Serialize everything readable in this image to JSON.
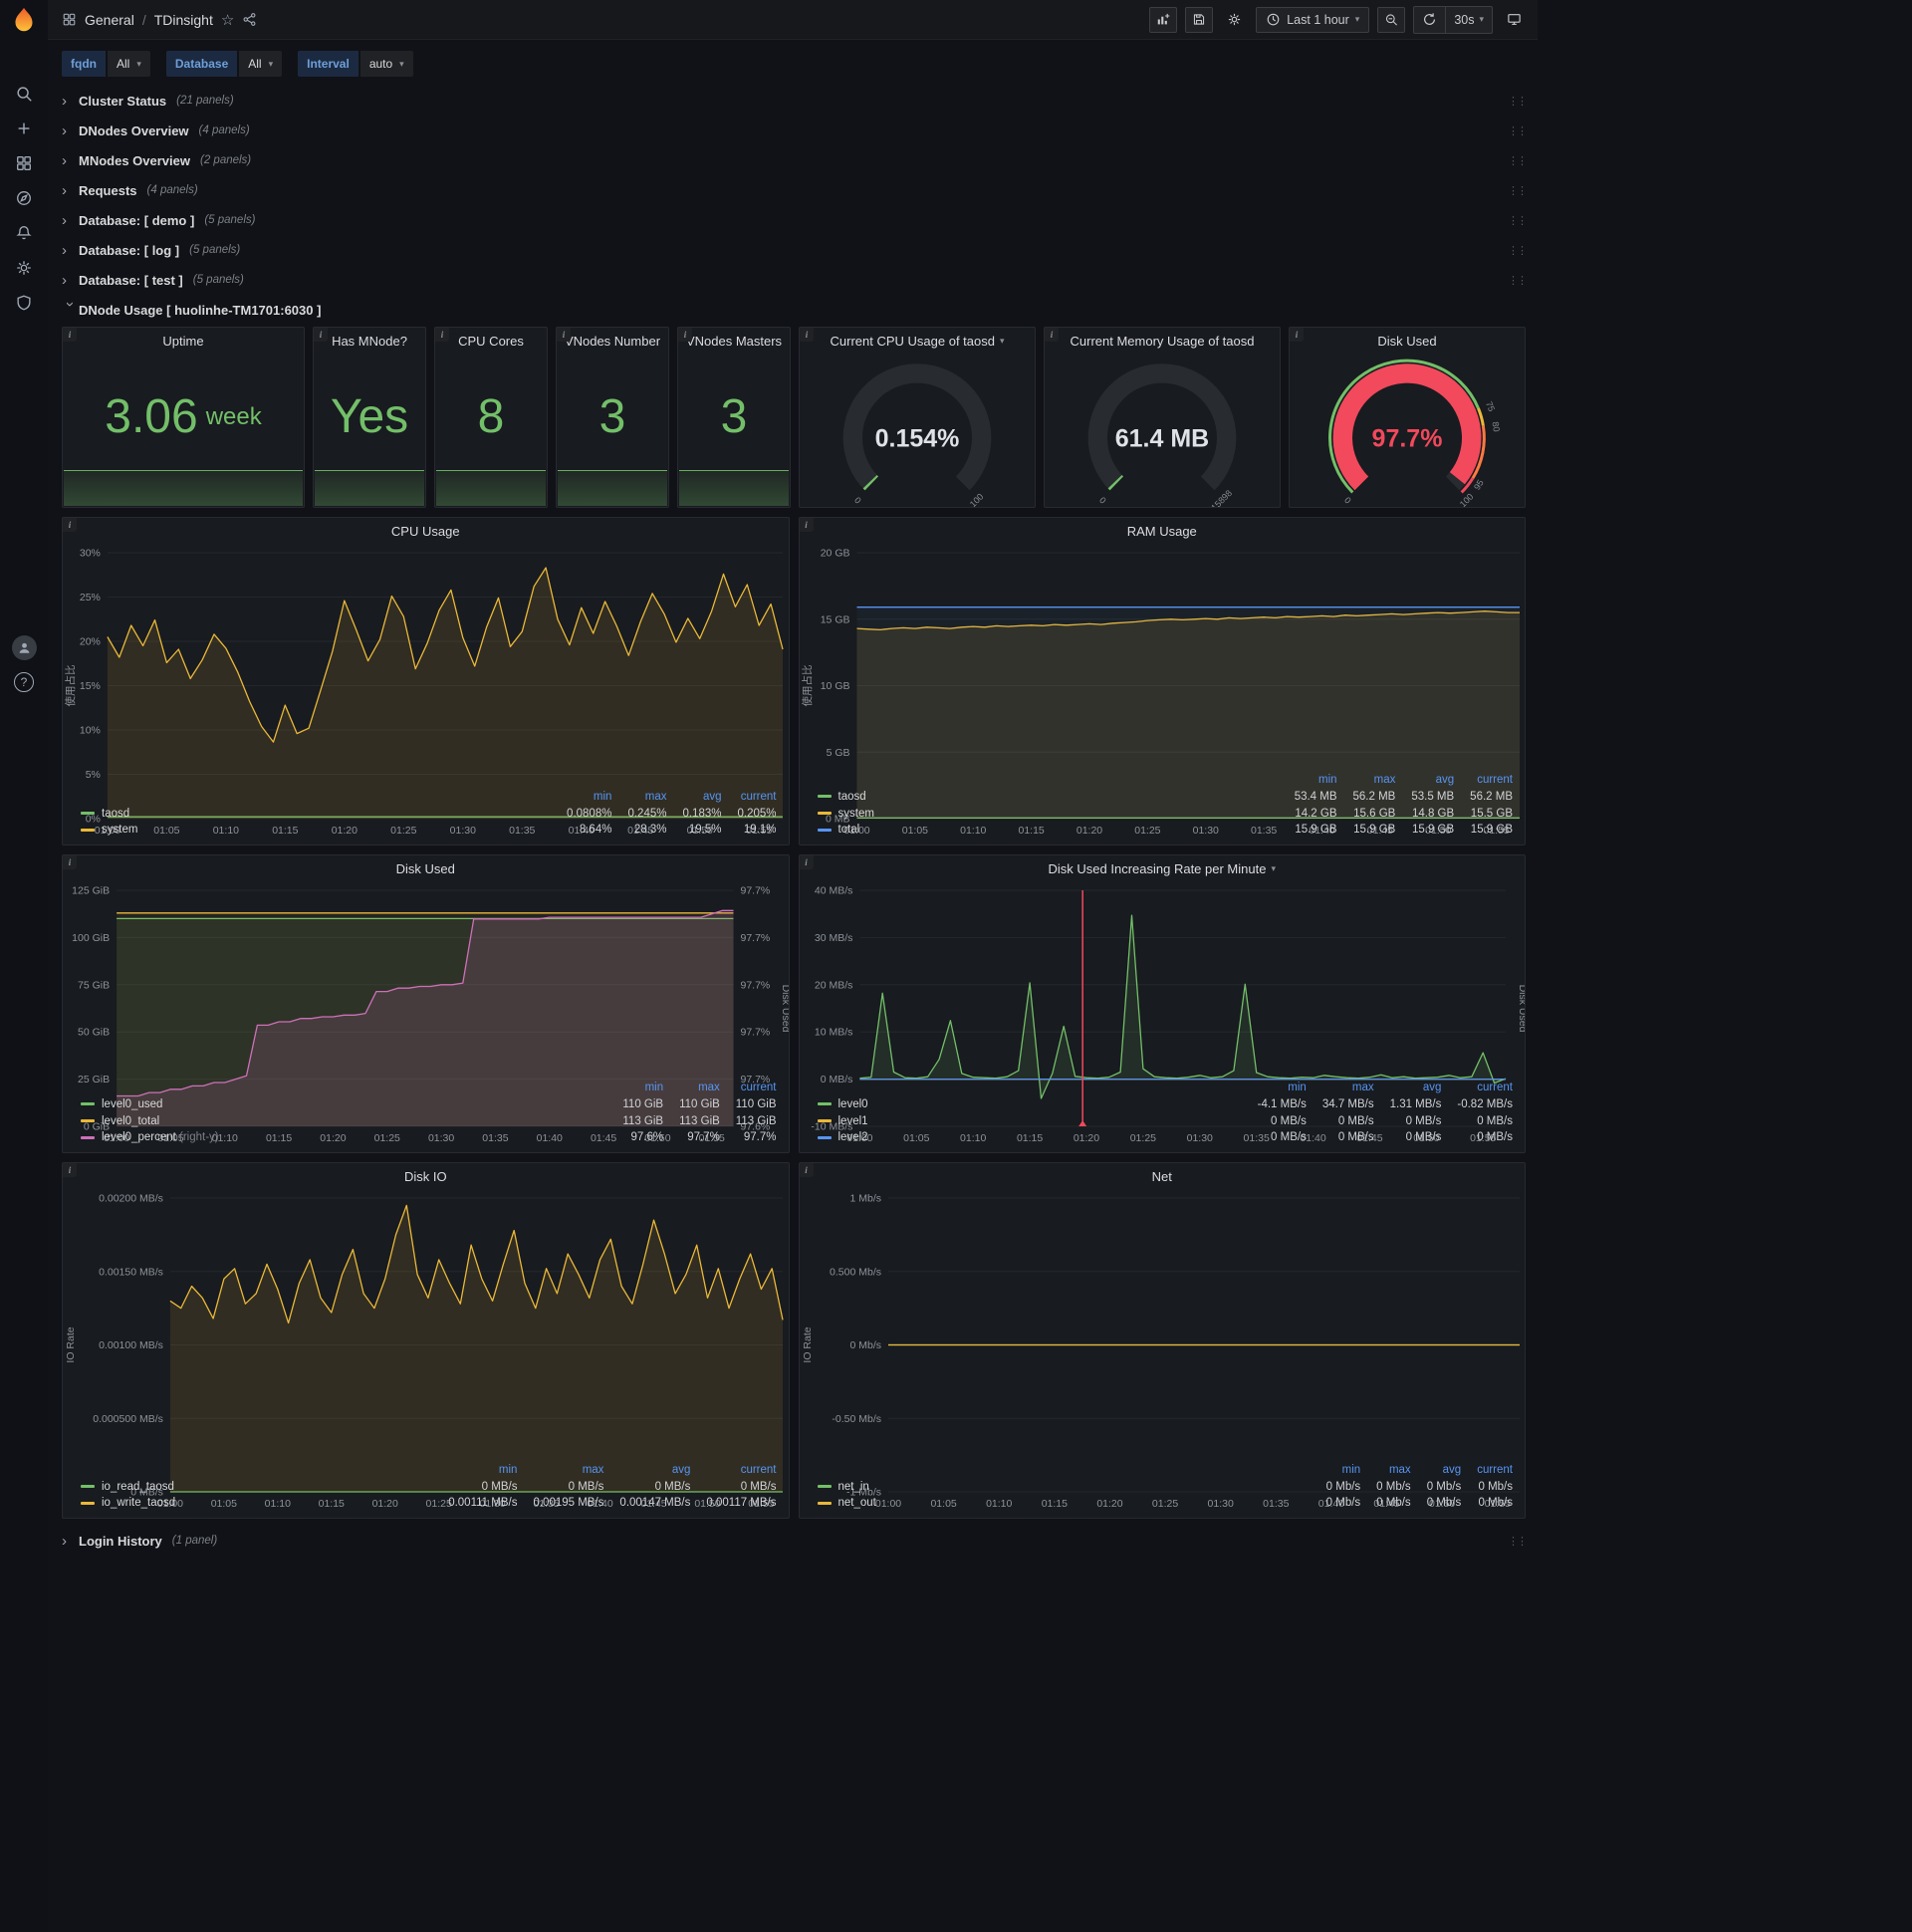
{
  "colors": {
    "green": "#73bf69",
    "yellow": "#eab839",
    "blue": "#5794f2",
    "red": "#f2495c",
    "pink": "#ce70b8",
    "orange": "#ff7941",
    "legend_header": "#5794f2"
  },
  "icons": {
    "info": "i",
    "chevron_right": "›",
    "caret_down": "▾",
    "star": "☆",
    "drag_dots": "⋮⋮",
    "help": "?"
  },
  "sidebar": {
    "icons": [
      "search",
      "plus",
      "dashboards",
      "explore",
      "alerting",
      "settings",
      "shield"
    ],
    "bottom_icons": [
      "avatar",
      "help"
    ]
  },
  "header": {
    "breadcrumb": {
      "section": "General",
      "separator": "/",
      "title": "TDinsight"
    },
    "time_picker": {
      "label": "Last 1 hour"
    },
    "refresh": {
      "interval": "30s"
    }
  },
  "variables": [
    {
      "label": "fqdn",
      "value": "All"
    },
    {
      "label": "Database",
      "value": "All"
    },
    {
      "label": "Interval",
      "value": "auto"
    }
  ],
  "rows_top": [
    {
      "title": "Cluster Status",
      "count": "(21 panels)"
    },
    {
      "title": "DNodes Overview",
      "count": "(4 panels)"
    },
    {
      "title": "MNodes Overview",
      "count": "(2 panels)"
    },
    {
      "title": "Requests",
      "count": "(4 panels)"
    },
    {
      "title": "Database: [ demo ]",
      "count": "(5 panels)"
    },
    {
      "title": "Database: [ log ]",
      "count": "(5 panels)"
    },
    {
      "title": "Database: [ test ]",
      "count": "(5 panels)"
    }
  ],
  "expanded_row": {
    "title": "DNode Usage [ huolinhe-TM1701:6030 ]"
  },
  "row_bottom": {
    "title": "Login History",
    "count": "(1 panel)"
  },
  "stats": [
    {
      "title": "Uptime",
      "value": "3.06",
      "unit": "week"
    },
    {
      "title": "Has MNode?",
      "value": "Yes",
      "unit": ""
    },
    {
      "title": "CPU Cores",
      "value": "8",
      "unit": ""
    },
    {
      "title": "VNodes Number",
      "value": "3",
      "unit": ""
    },
    {
      "title": "VNodes Masters",
      "value": "3",
      "unit": ""
    }
  ],
  "gauges": [
    {
      "title": "Current CPU Usage of taosd",
      "value": "0.154%",
      "fraction": 0.00154,
      "bar_color": "green",
      "value_color": "#dfe2e6",
      "labels": [
        {
          "f": 0,
          "t": "0"
        },
        {
          "f": 1,
          "t": "100"
        }
      ]
    },
    {
      "title": "Current Memory Usage of taosd",
      "value": "61.4 MB",
      "fraction": 0.0039,
      "bar_color": "green",
      "value_color": "#dfe2e6",
      "labels": [
        {
          "f": 0,
          "t": "0"
        },
        {
          "f": 1,
          "t": "15898"
        }
      ]
    },
    {
      "title": "Disk Used",
      "value": "97.7%",
      "fraction": 0.977,
      "bar_color": "red",
      "value_color": "#f2495c",
      "bands": [
        {
          "from": 0,
          "to": 0.75,
          "color": "green"
        },
        {
          "from": 0.75,
          "to": 0.8,
          "color": "yellow"
        },
        {
          "from": 0.8,
          "to": 0.95,
          "color": "orange"
        },
        {
          "from": 0.95,
          "to": 1,
          "color": "red"
        }
      ],
      "labels": [
        {
          "f": 0,
          "t": "0"
        },
        {
          "f": 0.75,
          "t": "75"
        },
        {
          "f": 0.8,
          "t": "80"
        },
        {
          "f": 0.95,
          "t": "95"
        },
        {
          "f": 1,
          "t": "100"
        }
      ]
    }
  ],
  "chart_data": [
    {
      "type": "line",
      "title": "CPU Usage",
      "y_label": "使用占比",
      "y_ticks": [
        "30%",
        "25%",
        "20%",
        "15%",
        "10%",
        "5%",
        "0%"
      ],
      "y_min": 0,
      "y_max": 30,
      "x_span": 57,
      "x_ticks": [
        "01:00",
        "01:05",
        "01:10",
        "01:15",
        "01:20",
        "01:25",
        "01:30",
        "01:35",
        "01:40",
        "01:45",
        "01:50",
        "01:55"
      ],
      "series": [
        {
          "name": "taosd",
          "color": "green",
          "fill_opacity": 0.1,
          "values": [
            0.2,
            0.2
          ]
        },
        {
          "name": "system",
          "color": "yellow",
          "fill_opacity": 0.12,
          "values": [
            20.5,
            18.2,
            21.8,
            19.5,
            22.4,
            17.6,
            19.1,
            15.8,
            17.9,
            20.8,
            19.2,
            16.5,
            13.2,
            10.4,
            8.64,
            12.8,
            9.6,
            10.2,
            14.5,
            18.9,
            24.6,
            21.3,
            17.8,
            20.2,
            25.1,
            22.8,
            16.9,
            19.8,
            23.5,
            25.8,
            20.4,
            17.2,
            21.6,
            24.9,
            19.4,
            21.1,
            26.2,
            28.3,
            22.5,
            19.6,
            23.8,
            20.9,
            24.5,
            21.7,
            18.4,
            22.2,
            25.4,
            23.1,
            19.9,
            22.6,
            20.3,
            23.4,
            27.6,
            23.9,
            26.4,
            21.8,
            24.2,
            19.1
          ]
        }
      ],
      "legend": {
        "columns": [
          "min",
          "max",
          "avg",
          "current"
        ],
        "rows": [
          {
            "name": "taosd",
            "color": "green",
            "values": [
              "0.0808%",
              "0.245%",
              "0.183%",
              "0.205%"
            ]
          },
          {
            "name": "system",
            "color": "yellow",
            "values": [
              "8.64%",
              "28.3%",
              "19.5%",
              "19.1%"
            ]
          }
        ]
      }
    },
    {
      "type": "line",
      "title": "RAM Usage",
      "y_label": "使用占比",
      "y_ticks": [
        "20 GB",
        "15 GB",
        "10 GB",
        "5 GB",
        "0 MB"
      ],
      "y_min": 0,
      "y_max": 20,
      "x_span": 57,
      "x_ticks": [
        "01:00",
        "01:05",
        "01:10",
        "01:15",
        "01:20",
        "01:25",
        "01:30",
        "01:35",
        "01:40",
        "01:45",
        "01:50",
        "01:55"
      ],
      "series": [
        {
          "name": "taosd",
          "color": "green",
          "fill_opacity": 0.1,
          "values": [
            0.053,
            0.053
          ]
        },
        {
          "name": "system",
          "color": "yellow",
          "fill_opacity": 0.12,
          "values": [
            14.3,
            14.25,
            14.2,
            14.3,
            14.35,
            14.3,
            14.4,
            14.35,
            14.3,
            14.4,
            14.45,
            14.4,
            14.5,
            14.45,
            14.5,
            14.55,
            14.5,
            14.6,
            14.55,
            14.6,
            14.65,
            14.6,
            14.7,
            14.75,
            14.8,
            14.9,
            14.95,
            15.0,
            14.95,
            15.0,
            15.05,
            15.0,
            15.1,
            15.05,
            15.1,
            15.15,
            15.1,
            15.2,
            15.15,
            15.2,
            15.25,
            15.2,
            15.3,
            15.25,
            15.3,
            15.35,
            15.4,
            15.35,
            15.4,
            15.45,
            15.5,
            15.45,
            15.5,
            15.55,
            15.6,
            15.55,
            15.5,
            15.5
          ]
        },
        {
          "name": "total",
          "color": "blue",
          "fill_opacity": 0.05,
          "values": [
            15.9,
            15.9
          ]
        }
      ],
      "legend": {
        "columns": [
          "min",
          "max",
          "avg",
          "current"
        ],
        "rows": [
          {
            "name": "taosd",
            "color": "green",
            "values": [
              "53.4 MB",
              "56.2 MB",
              "53.5 MB",
              "56.2 MB"
            ]
          },
          {
            "name": "system",
            "color": "yellow",
            "values": [
              "14.2 GB",
              "15.6 GB",
              "14.8 GB",
              "15.5 GB"
            ]
          },
          {
            "name": "total",
            "color": "blue",
            "values": [
              "15.9 GB",
              "15.9 GB",
              "15.9 GB",
              "15.9 GB"
            ]
          }
        ]
      }
    },
    {
      "type": "line",
      "title": "Disk Used",
      "y_ticks": [
        "125 GiB",
        "100 GiB",
        "75 GiB",
        "50 GiB",
        "25 GiB",
        "0 GiB"
      ],
      "y_min": 0,
      "y_max": 125,
      "x_span": 57,
      "right_ticks": [
        "97.7%",
        "97.7%",
        "97.7%",
        "97.7%",
        "97.7%",
        "97.6%"
      ],
      "y2_min": 97.58,
      "y2_max": 97.72,
      "right_label": "Disk Used",
      "x_ticks": [
        "01:00",
        "01:05",
        "01:10",
        "01:15",
        "01:20",
        "01:25",
        "01:30",
        "01:35",
        "01:40",
        "01:45",
        "01:50",
        "01:55"
      ],
      "series": [
        {
          "name": "level0_used",
          "color": "green",
          "fill_opacity": 0.1,
          "values": [
            110,
            110
          ]
        },
        {
          "name": "level0_total",
          "color": "yellow",
          "fill_opacity": 0.06,
          "values": [
            113,
            113
          ]
        },
        {
          "name": "level0_percent",
          "color": "pink",
          "axis": "right",
          "fill_opacity": 0.16,
          "values": [
            97.598,
            97.598,
            97.598,
            97.6,
            97.6,
            97.602,
            97.602,
            97.604,
            97.604,
            97.606,
            97.606,
            97.608,
            97.61,
            97.64,
            97.64,
            97.642,
            97.642,
            97.644,
            97.644,
            97.645,
            97.645,
            97.646,
            97.646,
            97.647,
            97.66,
            97.66,
            97.662,
            97.662,
            97.663,
            97.663,
            97.664,
            97.664,
            97.665,
            97.703,
            97.703,
            97.703,
            97.703,
            97.703,
            97.703,
            97.703,
            97.704,
            97.704,
            97.704,
            97.704,
            97.704,
            97.704,
            97.704,
            97.704,
            97.704,
            97.704,
            97.704,
            97.704,
            97.704,
            97.704,
            97.704,
            97.706,
            97.708,
            97.708
          ]
        }
      ],
      "legend": {
        "columns": [
          "min",
          "max",
          "current"
        ],
        "rows": [
          {
            "name": "level0_used",
            "color": "green",
            "values": [
              "110 GiB",
              "110 GiB",
              "110 GiB"
            ]
          },
          {
            "name": "level0_total",
            "color": "yellow",
            "values": [
              "113 GiB",
              "113 GiB",
              "113 GiB"
            ]
          },
          {
            "name": "level0_percent",
            "color": "pink",
            "note": "(right-y)",
            "values": [
              "97.6%",
              "97.7%",
              "97.7%"
            ]
          }
        ]
      }
    },
    {
      "type": "line",
      "title": "Disk Used Increasing Rate per Minute",
      "title_caret": true,
      "y_ticks": [
        "40 MB/s",
        "30 MB/s",
        "20 MB/s",
        "10 MB/s",
        "0 MB/s",
        "-10 MB/s"
      ],
      "y_min": -10,
      "y_max": 40,
      "x_span": 57,
      "right_label": "Disk Used",
      "x_ticks": [
        "01:00",
        "01:05",
        "01:10",
        "01:15",
        "01:20",
        "01:25",
        "01:30",
        "01:35",
        "01:40",
        "01:45",
        "01:50",
        "01:55"
      ],
      "annotations": [
        {
          "x": 0.345,
          "color": "red"
        }
      ],
      "series": [
        {
          "name": "level0",
          "color": "green",
          "fill_opacity": 0.12,
          "values": [
            0.2,
            0.4,
            18.2,
            1.5,
            0.3,
            0.2,
            0.5,
            4.2,
            12.4,
            1.2,
            0.4,
            0.3,
            0.2,
            0.5,
            1.8,
            20.4,
            -4.1,
            1.2,
            11.2,
            0.6,
            0.3,
            0.2,
            0.4,
            1.5,
            34.7,
            2.2,
            0.5,
            0.3,
            0.2,
            0.4,
            0.8,
            0.3,
            0.5,
            1.8,
            20.1,
            1.4,
            0.5,
            0.3,
            0.2,
            0.4,
            0.3,
            0.8,
            0.5,
            0.3,
            0.2,
            0.4,
            0.9,
            0.3,
            0.5,
            0.2,
            0.3,
            0.4,
            0.8,
            0.3,
            0.5,
            5.6,
            -0.82,
            0.1
          ]
        },
        {
          "name": "level1",
          "color": "yellow",
          "values": [
            0,
            0
          ]
        },
        {
          "name": "level2",
          "color": "blue",
          "values": [
            0,
            0
          ]
        }
      ],
      "legend": {
        "columns": [
          "min",
          "max",
          "avg",
          "current"
        ],
        "rows": [
          {
            "name": "level0",
            "color": "green",
            "values": [
              "-4.1 MB/s",
              "34.7 MB/s",
              "1.31 MB/s",
              "-0.82 MB/s"
            ]
          },
          {
            "name": "level1",
            "color": "yellow",
            "values": [
              "0 MB/s",
              "0 MB/s",
              "0 MB/s",
              "0 MB/s"
            ]
          },
          {
            "name": "level2",
            "color": "blue",
            "values": [
              "0 MB/s",
              "0 MB/s",
              "0 MB/s",
              "0 MB/s"
            ]
          }
        ]
      }
    },
    {
      "type": "line",
      "title": "Disk IO",
      "y_label": "IO Rate",
      "y_ticks": [
        "0.00200 MB/s",
        "0.00150 MB/s",
        "0.00100 MB/s",
        "0.000500 MB/s",
        "0 MB/s"
      ],
      "y_min": 0,
      "y_max": 0.002,
      "x_span": 57,
      "x_ticks": [
        "01:00",
        "01:05",
        "01:10",
        "01:15",
        "01:20",
        "01:25",
        "01:30",
        "01:35",
        "01:40",
        "01:45",
        "01:50",
        "01:55"
      ],
      "series": [
        {
          "name": "io_read_taosd",
          "color": "green",
          "fill_opacity": 0.1,
          "values": [
            0,
            0
          ]
        },
        {
          "name": "io_write_taosd",
          "color": "yellow",
          "fill_opacity": 0.12,
          "values": [
            0.0013,
            0.00125,
            0.0014,
            0.00132,
            0.00118,
            0.00145,
            0.00152,
            0.00128,
            0.00135,
            0.00155,
            0.00138,
            0.00115,
            0.00142,
            0.00158,
            0.00132,
            0.00122,
            0.00148,
            0.00165,
            0.00135,
            0.00125,
            0.00145,
            0.00175,
            0.00195,
            0.00148,
            0.00132,
            0.00158,
            0.00142,
            0.00128,
            0.00168,
            0.00145,
            0.0013,
            0.00155,
            0.00178,
            0.00142,
            0.00125,
            0.00152,
            0.00135,
            0.00162,
            0.00148,
            0.00132,
            0.00158,
            0.00172,
            0.0014,
            0.00128,
            0.00155,
            0.00185,
            0.00162,
            0.00135,
            0.00148,
            0.00168,
            0.00132,
            0.00152,
            0.00125,
            0.00145,
            0.00162,
            0.00138,
            0.00152,
            0.00117
          ]
        }
      ],
      "legend": {
        "columns": [
          "min",
          "max",
          "avg",
          "current"
        ],
        "rows": [
          {
            "name": "io_read_taosd",
            "color": "green",
            "values": [
              "0 MB/s",
              "0 MB/s",
              "0 MB/s",
              "0 MB/s"
            ]
          },
          {
            "name": "io_write_taosd",
            "color": "yellow",
            "values": [
              "0.00111 MB/s",
              "0.00195 MB/s",
              "0.00147 MB/s",
              "0.00117 MB/s"
            ]
          }
        ]
      }
    },
    {
      "type": "line",
      "title": "Net",
      "y_label": "IO Rate",
      "y_ticks": [
        "1 Mb/s",
        "0.500 Mb/s",
        "0 Mb/s",
        "-0.50 Mb/s",
        "-1 Mb/s"
      ],
      "y_min": -1,
      "y_max": 1,
      "x_span": 57,
      "x_ticks": [
        "01:00",
        "01:05",
        "01:10",
        "01:15",
        "01:20",
        "01:25",
        "01:30",
        "01:35",
        "01:40",
        "01:45",
        "01:50",
        "01:55"
      ],
      "series": [
        {
          "name": "net_in",
          "color": "green",
          "values": [
            0,
            0
          ]
        },
        {
          "name": "net_out",
          "color": "yellow",
          "values": [
            0,
            0
          ]
        }
      ],
      "legend": {
        "columns": [
          "min",
          "max",
          "avg",
          "current"
        ],
        "rows": [
          {
            "name": "net_in",
            "color": "green",
            "values": [
              "0 Mb/s",
              "0 Mb/s",
              "0 Mb/s",
              "0 Mb/s"
            ]
          },
          {
            "name": "net_out",
            "color": "yellow",
            "values": [
              "0 Mb/s",
              "0 Mb/s",
              "0 Mb/s",
              "0 Mb/s"
            ]
          }
        ]
      }
    }
  ]
}
